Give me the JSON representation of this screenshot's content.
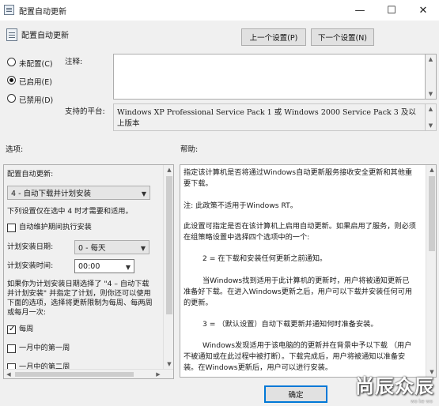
{
  "window": {
    "title": "配置自动更新",
    "header": "配置自动更新"
  },
  "titlebar": {
    "minimize": "—",
    "maximize": "☐",
    "close": "✕"
  },
  "nav": {
    "prev": "上一个设置(P)",
    "next": "下一个设置(N)"
  },
  "state": {
    "options": [
      {
        "label": "未配置(C)",
        "selected": false
      },
      {
        "label": "已启用(E)",
        "selected": true
      },
      {
        "label": "已禁用(D)",
        "selected": false
      }
    ]
  },
  "comment": {
    "label": "注释:",
    "value": ""
  },
  "platform": {
    "label": "支持的平台:",
    "value": "Windows XP Professional Service Pack 1 或 Windows 2000 Service Pack 3 及以上版本"
  },
  "sections": {
    "options": "选项:",
    "help": "帮助:"
  },
  "options": {
    "config_label": "配置自动更新:",
    "config_value": "4 - 自动下载并计划安装",
    "note": "下列设置仅在选中 4 时才需要和适用。",
    "maint_label": "自动维护期间执行安装",
    "date_label": "计划安装日期:",
    "date_value": "0 - 每天",
    "time_label": "计划安装时间:",
    "time_value": "00:00",
    "desc": [
      "如果你为计划安装日期选择了 \"4 – 自动下载",
      "并计划安装\" 并指定了计划，则你还可以使用",
      "下面的选项，选择将更新限制为每周、每两周",
      "或每月一次:"
    ],
    "weekly_label": "每周",
    "first_week_label": "一月中的第一周",
    "second_week_label": "一月中的第二周"
  },
  "help": {
    "p1": [
      "指定该计算机是否将通过Windows自动更新服务接收安全更新和其他重",
      "要下载。"
    ],
    "p2": "注: 此政策不适用于Windows RT。",
    "p3": [
      "此设置可指定是否在该计算机上启用自动更新。如果启用了服务，则必须",
      "在组策略设置中选择四个选项中的一个:"
    ],
    "p4": "2 = 在下载和安装任何更新之前通知。",
    "p5": [
      "当Windows找到适用于此计算机的更新时，用户将被通知更新已",
      "准备好下载。在进入Windows更新之后，用户可以下载并安装任何可用",
      "的更新。"
    ],
    "p6": "3 = （默认设置）自动下载更新并通知何时准备安装。",
    "p7": [
      "Windows发现适用于该电脑的的更新并在背景中予以下载 （用户",
      "不被通知或在此过程中被打断）。下载完成后，用户将被通知以准备安",
      "装。在Windows更新后，用户可以进行安装。"
    ]
  },
  "footer": {
    "ok": "确定"
  },
  "watermark": {
    "text": "尚辰众辰",
    "sub": "wo ke wo"
  }
}
